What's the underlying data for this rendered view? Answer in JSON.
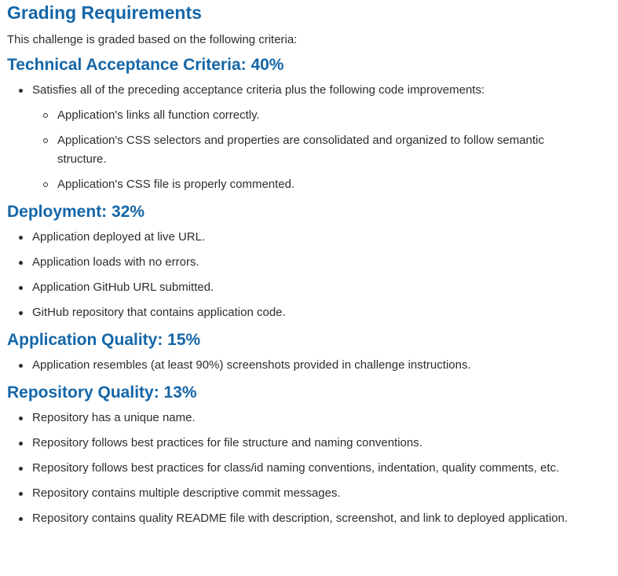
{
  "title": "Grading Requirements",
  "intro": "This challenge is graded based on the following criteria:",
  "sections": [
    {
      "heading": "Technical Acceptance Criteria: 40%",
      "items": [
        {
          "text": "Satisfies all of the preceding acceptance criteria plus the following code improvements:",
          "subitems": [
            "Application's links all function correctly.",
            "Application's CSS selectors and properties are consolidated and organized to follow semantic structure.",
            "Application's CSS file is properly commented."
          ]
        }
      ]
    },
    {
      "heading": "Deployment: 32%",
      "items": [
        "Application deployed at live URL.",
        "Application loads with no errors.",
        "Application GitHub URL submitted.",
        "GitHub repository that contains application code."
      ]
    },
    {
      "heading": "Application Quality: 15%",
      "items": [
        "Application resembles (at least 90%) screenshots provided in challenge instructions."
      ]
    },
    {
      "heading": "Repository Quality: 13%",
      "items": [
        "Repository has a unique name.",
        "Repository follows best practices for file structure and naming conventions.",
        "Repository follows best practices for class/id naming conventions, indentation, quality comments, etc.",
        "Repository contains multiple descriptive commit messages.",
        "Repository contains quality README file with description, screenshot, and link to deployed application."
      ]
    }
  ]
}
